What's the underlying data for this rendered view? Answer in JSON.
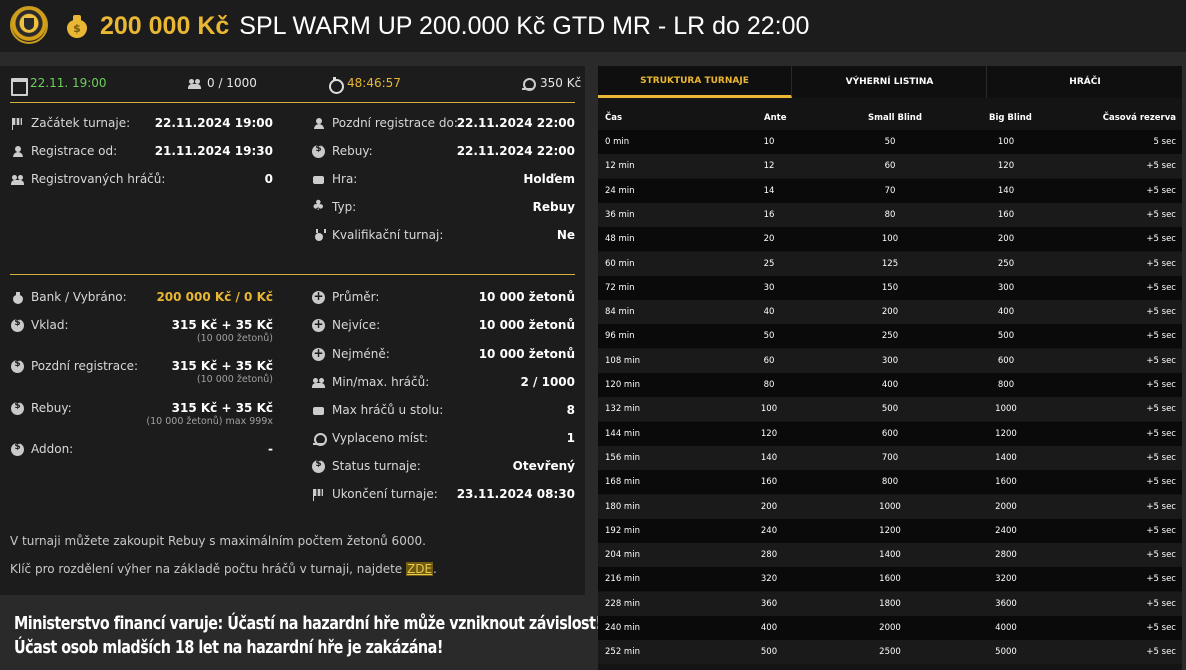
{
  "header": {
    "prize": "200 000 Kč",
    "title": "SPL WARM UP 200.000 Kč GTD MR - LR do 22:00"
  },
  "topstats": {
    "date": "22.11. 19:00",
    "players": "0 / 1000",
    "countdown": "48:46:57",
    "buyin": "350 Kč"
  },
  "info_left": [
    {
      "label": "Začátek turnaje:",
      "value": "22.11.2024 19:00",
      "icon": "flag-icon"
    },
    {
      "label": "Registrace od:",
      "value": "21.11.2024 19:30",
      "icon": "user-icon"
    },
    {
      "label": "Registrovaných hráčů:",
      "value": "0",
      "icon": "users-icon"
    }
  ],
  "info_right": [
    {
      "label": "Pozdní registrace do:",
      "value": "22.11.2024 22:00",
      "icon": "user-icon"
    },
    {
      "label": "Rebuy:",
      "value": "22.11.2024 22:00",
      "icon": "coin-icon"
    },
    {
      "label": "Hra:",
      "value": "Holďem",
      "icon": "card-icon"
    },
    {
      "label": "Typ:",
      "value": "Rebuy",
      "icon": "clubs-icon"
    },
    {
      "label": "Kvalifikační turnaj:",
      "value": "Ne",
      "icon": "medal-icon"
    }
  ],
  "money_left": [
    {
      "label": "Bank / Vybráno:",
      "value": "200 000 Kč / 0 Kč",
      "sub": "",
      "icon": "bag-icon"
    },
    {
      "label": "Vklad:",
      "value": "315 Kč + 35 Kč",
      "sub": "(10 000 žetonů)",
      "icon": "coin-icon"
    },
    {
      "label": "Pozdní registrace:",
      "value": "315 Kč + 35 Kč",
      "sub": "(10 000 žetonů)",
      "icon": "coin-icon"
    },
    {
      "label": "Rebuy:",
      "value": "315 Kč + 35 Kč",
      "sub": "(10 000 žetonů) max 999x",
      "icon": "coin-icon"
    },
    {
      "label": "Addon:",
      "value": "-",
      "sub": "",
      "icon": "coin-icon"
    }
  ],
  "money_right": [
    {
      "label": "Průměr:",
      "value": "10 000 žetonů",
      "icon": "plus-icon"
    },
    {
      "label": "Nejvíce:",
      "value": "10 000 žetonů",
      "icon": "plus-icon"
    },
    {
      "label": "Nejméně:",
      "value": "10 000 žetonů",
      "icon": "plus-icon"
    },
    {
      "label": "Min/max. hráčů:",
      "value": "2 / 1000",
      "icon": "users-icon"
    },
    {
      "label": "Max hráčů u stolu:",
      "value": "8",
      "icon": "card-icon"
    },
    {
      "label": "Vyplaceno míst:",
      "value": "1",
      "icon": "chip-icon"
    },
    {
      "label": "Status turnaje:",
      "value": "Otevřený",
      "icon": "coin-icon"
    },
    {
      "label": "Ukončení turnaje:",
      "value": "23.11.2024 08:30",
      "icon": "flag-icon"
    }
  ],
  "notes": {
    "rebuy_text": "V turnaji můžete zakoupit Rebuy s maximálním počtem žetonů 6000.",
    "payout_text": "Klíč pro rozdělení výher na základě počtu hráčů v turnaji, najdete",
    "payout_link": "ZDE",
    "payout_end": "."
  },
  "warning": {
    "line1": "Ministerstvo financí varuje: Účastí na hazardní hře může vzniknout závislost!",
    "line2": "Účast osob mladších 18 let na hazardní hře je zakázána!"
  },
  "tabs": [
    "STRUKTURA TURNAJE",
    "VÝHERNÍ LISTINA",
    "HRÁČI"
  ],
  "structure": {
    "headers": [
      "Čas",
      "Ante",
      "Small Blind",
      "Big Blind",
      "Časová rezerva"
    ],
    "rows": [
      [
        "0 min",
        "10",
        "50",
        "100",
        "5 sec"
      ],
      [
        "12 min",
        "12",
        "60",
        "120",
        "+5 sec"
      ],
      [
        "24 min",
        "14",
        "70",
        "140",
        "+5 sec"
      ],
      [
        "36 min",
        "16",
        "80",
        "160",
        "+5 sec"
      ],
      [
        "48 min",
        "20",
        "100",
        "200",
        "+5 sec"
      ],
      [
        "60 min",
        "25",
        "125",
        "250",
        "+5 sec"
      ],
      [
        "72 min",
        "30",
        "150",
        "300",
        "+5 sec"
      ],
      [
        "84 min",
        "40",
        "200",
        "400",
        "+5 sec"
      ],
      [
        "96 min",
        "50",
        "250",
        "500",
        "+5 sec"
      ],
      [
        "108 min",
        "60",
        "300",
        "600",
        "+5 sec"
      ],
      [
        "120 min",
        "80",
        "400",
        "800",
        "+5 sec"
      ],
      [
        "132 min",
        "100",
        "500",
        "1000",
        "+5 sec"
      ],
      [
        "144 min",
        "120",
        "600",
        "1200",
        "+5 sec"
      ],
      [
        "156 min",
        "140",
        "700",
        "1400",
        "+5 sec"
      ],
      [
        "168 min",
        "160",
        "800",
        "1600",
        "+5 sec"
      ],
      [
        "180 min",
        "200",
        "1000",
        "2000",
        "+5 sec"
      ],
      [
        "192 min",
        "240",
        "1200",
        "2400",
        "+5 sec"
      ],
      [
        "204 min",
        "280",
        "1400",
        "2800",
        "+5 sec"
      ],
      [
        "216 min",
        "320",
        "1600",
        "3200",
        "+5 sec"
      ],
      [
        "228 min",
        "360",
        "1800",
        "3600",
        "+5 sec"
      ],
      [
        "240 min",
        "400",
        "2000",
        "4000",
        "+5 sec"
      ],
      [
        "252 min",
        "500",
        "2500",
        "5000",
        "+5 sec"
      ]
    ]
  }
}
